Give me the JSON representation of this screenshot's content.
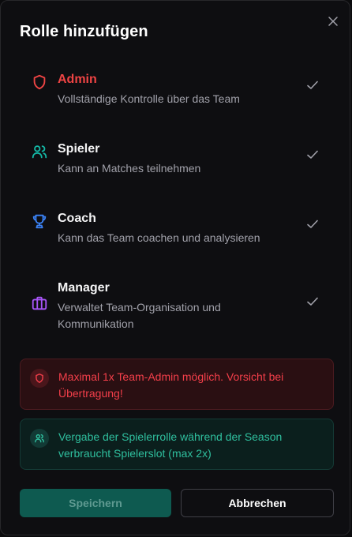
{
  "dialog": {
    "title": "Rolle hinzufügen",
    "close_icon": "x-icon"
  },
  "roles": [
    {
      "name": "Admin",
      "description": "Vollständige Kontrolle über das Team",
      "icon": "shield-icon",
      "color": "#ef4444",
      "checked": true
    },
    {
      "name": "Spieler",
      "description": "Kann an Matches teilnehmen",
      "icon": "users-icon",
      "color": "#14b8a6",
      "checked": true
    },
    {
      "name": "Coach",
      "description": "Kann das Team coachen und analysieren",
      "icon": "trophy-icon",
      "color": "#3b82f6",
      "checked": true
    },
    {
      "name": "Manager",
      "description": "Verwaltet Team-Organisation und Kommunikation",
      "icon": "briefcase-icon",
      "color": "#a855f7",
      "checked": true
    }
  ],
  "notices": {
    "warning": {
      "text": "Maximal 1x Team-Admin möglich. Vorsicht bei Übertragung!",
      "icon": "shield-icon",
      "color": "#f43f4a"
    },
    "info": {
      "text": "Vergabe der Spielerrolle während der Season verbraucht Spielerslot (max 2x)",
      "icon": "users-icon",
      "color": "#2fbf9e"
    }
  },
  "buttons": {
    "save_label": "Speichern",
    "cancel_label": "Abbrechen"
  }
}
